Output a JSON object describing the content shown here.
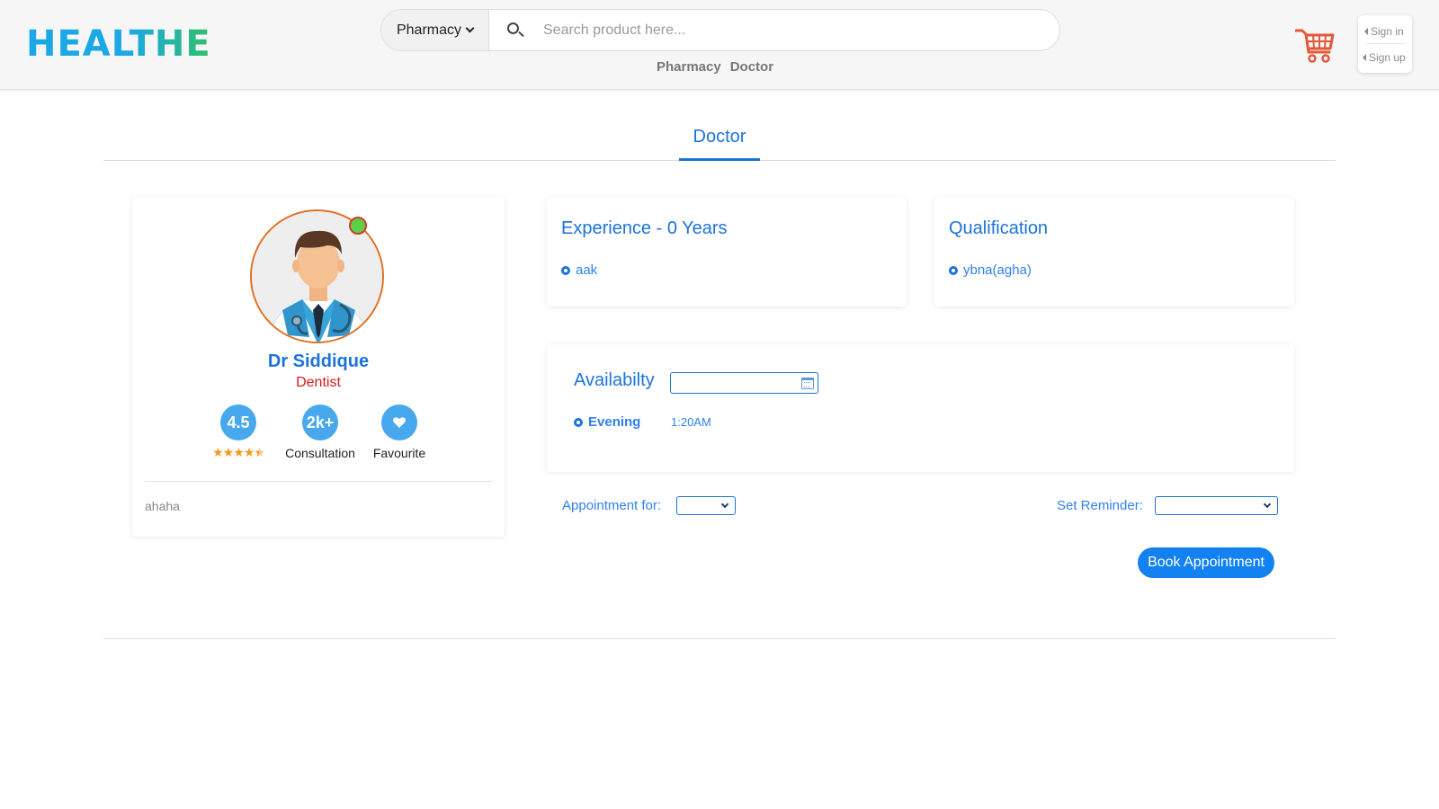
{
  "header": {
    "logo": "HEALTHE",
    "category_selected": "Pharmacy",
    "search_placeholder": "Search product here...",
    "nav": [
      "Pharmacy",
      "Doctor"
    ],
    "sign_in": "Sign in",
    "sign_up": "Sign up",
    "icons": {
      "search": "search-icon",
      "cart": "cart-icon"
    }
  },
  "tabs": {
    "active": "Doctor"
  },
  "profile": {
    "name": "Dr Siddique",
    "specialty": "Dentist",
    "rating": "4.5",
    "rating_stars": 4.5,
    "consultations": "2k+",
    "consultation_label": "Consultation",
    "favourite_label": "Favourite",
    "bio": "ahaha"
  },
  "experience": {
    "title": "Experience - 0 Years",
    "items": [
      "aak"
    ]
  },
  "qualification": {
    "title": "Qualification",
    "items": [
      "ybna(agha)"
    ]
  },
  "availability": {
    "title": "Availabilty",
    "slots": [
      {
        "label": "Evening",
        "time": "1:20AM"
      }
    ]
  },
  "appointment": {
    "for_label": "Appointment for:",
    "reminder_label": "Set Reminder:",
    "book_label": "Book Appointment"
  },
  "colors": {
    "primary": "#1a73d9",
    "button": "#1382f0",
    "specialty": "#d81b1b",
    "logo_from": "#1aa8e6",
    "logo_to": "#2fc06b",
    "online": "#5cd04a",
    "stars": "#f09a1b"
  }
}
